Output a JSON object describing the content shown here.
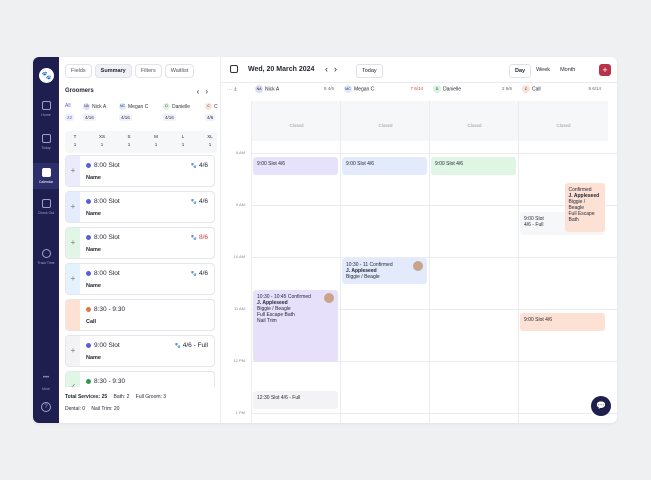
{
  "nav": {
    "items": [
      {
        "label": "Home",
        "icon": "home-icon"
      },
      {
        "label": "Today",
        "icon": "check-icon"
      },
      {
        "label": "Calendar",
        "icon": "calendar-icon"
      },
      {
        "label": "Check Out",
        "icon": "receipt-icon"
      },
      {
        "label": "Track Time",
        "icon": "clock-icon"
      },
      {
        "label": "More",
        "icon": "more-icon"
      }
    ],
    "help": "?"
  },
  "panel": {
    "tabs": [
      "Fields",
      "Summary",
      "Filters",
      "Waitlist"
    ],
    "active_tab": "Summary",
    "groomers_title": "Groomers",
    "groomer_tabs": [
      {
        "label": "All",
        "count": "22",
        "initials": "",
        "color": ""
      },
      {
        "label": "Nick A",
        "count": "4/16",
        "initials": "NA",
        "color": "#dcdcf7"
      },
      {
        "label": "Megan C",
        "count": "4/16",
        "initials": "MC",
        "color": "#dde8fb"
      },
      {
        "label": "Danielle",
        "count": "4/16",
        "initials": "D",
        "color": "#daf3de"
      },
      {
        "label": "C",
        "count": "4/6",
        "initials": "C",
        "color": "#fbe1d6"
      }
    ],
    "sizes": [
      {
        "label": "T",
        "n": "1"
      },
      {
        "label": "XS",
        "n": "1"
      },
      {
        "label": "S",
        "n": "1"
      },
      {
        "label": "M",
        "n": "1"
      },
      {
        "label": "L",
        "n": "1"
      },
      {
        "label": "XL",
        "n": "1"
      }
    ],
    "slots": [
      {
        "time": "8:00 Slot",
        "sub": "Name",
        "cap": "4/6",
        "bar": "#ebebfb",
        "icon": "+",
        "warn": false
      },
      {
        "time": "8:00 Slot",
        "sub": "Name",
        "cap": "4/6",
        "bar": "#e4ecfd",
        "icon": "+",
        "warn": false
      },
      {
        "time": "8:00 Slot",
        "sub": "Name",
        "cap": "8/6",
        "bar": "#e1f6e6",
        "icon": "+",
        "warn": true
      },
      {
        "time": "8:00 Slot",
        "sub": "Name",
        "cap": "4/6",
        "bar": "#e3f2fd",
        "icon": "+",
        "warn": false
      },
      {
        "time": "8:30 - 9:30",
        "sub": "Call",
        "cap": "",
        "bar": "#fde2d4",
        "icon": "",
        "warn": false,
        "dot": "#e0783f"
      },
      {
        "time": "9:00 Slot",
        "sub": "Name",
        "cap": "4/6 - Full",
        "bar": "#f3f3f5",
        "icon": "+",
        "warn": false
      },
      {
        "time": "8:30 - 9:30",
        "sub": "",
        "cap": "",
        "bar": "#e1f6e6",
        "icon": "✓",
        "warn": false,
        "dot": "#2e9a4f"
      }
    ],
    "totals": {
      "services": "Total Services: 25",
      "bath": "Bath: 2",
      "full_groom": "Full Groom: 3",
      "dental": "Dental: 0",
      "nail_trim": "Nail Trim: 20"
    }
  },
  "calendar": {
    "date": "Wed, 20 March 2024",
    "today": "Today",
    "views": [
      "Day",
      "Week",
      "Month"
    ],
    "active_view": "Day",
    "add": "+",
    "columns": [
      {
        "name": "Nick A",
        "initials": "NA",
        "color": "#dcdcf7",
        "meta": "8   4/6",
        "over": false
      },
      {
        "name": "Megan C",
        "initials": "MC",
        "color": "#dde8fb",
        "meta": "7   6/14",
        "over": true
      },
      {
        "name": "Danielle",
        "initials": "D",
        "color": "#daf3de",
        "meta": "2   6/6",
        "over": false
      },
      {
        "name": "Call",
        "initials": "C",
        "color": "#fbe1d6",
        "meta": "8   6/14",
        "over": false
      }
    ],
    "times": [
      "8 AM",
      "9 AM",
      "10 AM",
      "11 AM",
      "12 PM",
      "1 PM"
    ],
    "closed": "Closed",
    "events": [
      {
        "col": 0,
        "start": 0.0,
        "end": 0.35,
        "bg": "#e6e2fb",
        "lines": [
          "9:00 Slot   4/6"
        ]
      },
      {
        "col": 1,
        "start": 0.0,
        "end": 0.35,
        "bg": "#e2eafc",
        "lines": [
          "9:00 Slot   4/6"
        ]
      },
      {
        "col": 2,
        "start": 0.0,
        "end": 0.35,
        "bg": "#def6e3",
        "lines": [
          "9:00 Slot   4/6"
        ]
      },
      {
        "col": 3,
        "start": 1.05,
        "end": 1.5,
        "bg": "#f6f7f9",
        "lines": [
          "9:00 Slot",
          "4/6 - Full"
        ]
      },
      {
        "col": 3,
        "start": 0.5,
        "end": 1.45,
        "bg": "#fde1d4",
        "lines": [
          "Confirmed",
          "J. Appleseed",
          "Biggie / Beagle",
          "Full Escape Bath"
        ],
        "offset": 0.5
      },
      {
        "col": 1,
        "start": 1.95,
        "end": 2.45,
        "bg": "#e2eafc",
        "lines": [
          "10:30 - 11 Confirmed",
          "J. Appleseed",
          "Biggie / Beagle"
        ],
        "avatar": true
      },
      {
        "col": 0,
        "start": 2.55,
        "end": 3.95,
        "bg": "#e6e0fb",
        "lines": [
          "10:30 - 10:45 Confirmed",
          "J. Appleseed",
          "Biggie / Beagle",
          "Full Escape Bath",
          "Nail Trim"
        ],
        "avatar": true
      },
      {
        "col": 3,
        "start": 3.0,
        "end": 3.35,
        "bg": "#fde1d4",
        "lines": [
          "9:00 Slot   4/6"
        ]
      },
      {
        "col": 0,
        "start": 4.5,
        "end": 4.85,
        "bg": "#f3f3f5",
        "lines": [
          "12:30 Slot   4/6 - Full"
        ]
      }
    ]
  }
}
